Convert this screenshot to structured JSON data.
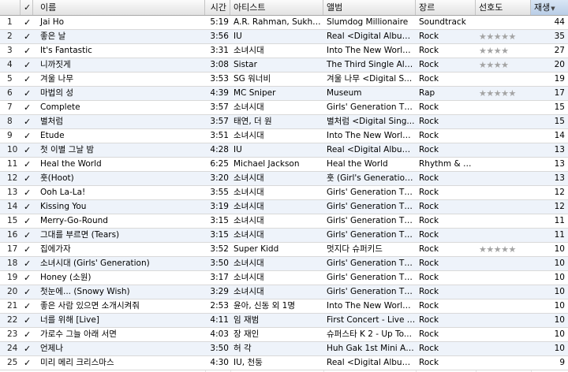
{
  "headers": {
    "check": "✓",
    "name": "이름",
    "time": "시간",
    "artist": "아티스트",
    "album": "앨범",
    "genre": "장르",
    "rating": "선호도",
    "plays": "재생"
  },
  "sort_column": "plays",
  "check_glyph": "✓",
  "rating_star_icon": "star-icon",
  "rows": [
    {
      "num": "1",
      "name": "Jai Ho",
      "time": "5:19",
      "artist": "A.R. Rahman, Sukhvi...",
      "album": "Slumdog Millionaire",
      "genre": "Soundtrack",
      "rating": 0,
      "plays": "44"
    },
    {
      "num": "2",
      "name": "좋은 날",
      "time": "3:56",
      "artist": "IU",
      "album": "Real <Digital Album>",
      "genre": "Rock",
      "rating": 5,
      "plays": "35"
    },
    {
      "num": "3",
      "name": "It's Fantastic",
      "time": "3:31",
      "artist": "소녀시대",
      "album": "Into The New World ...",
      "genre": "Rock",
      "rating": 4,
      "plays": "27"
    },
    {
      "num": "4",
      "name": "니까짓게",
      "time": "3:08",
      "artist": "Sistar",
      "album": "The Third Single Alb...",
      "genre": "Rock",
      "rating": 4,
      "plays": "20"
    },
    {
      "num": "5",
      "name": "겨울 나무",
      "time": "3:53",
      "artist": "SG 워너비",
      "album": "겨울 나무 <Digital S...",
      "genre": "Rock",
      "rating": 0,
      "plays": "19"
    },
    {
      "num": "6",
      "name": "마법의 성",
      "time": "4:39",
      "artist": "MC Sniper",
      "album": "Museum",
      "genre": "Rap",
      "rating": 5,
      "plays": "17"
    },
    {
      "num": "7",
      "name": "Complete",
      "time": "3:57",
      "artist": "소녀시대",
      "album": "Girls' Generation Th...",
      "genre": "Rock",
      "rating": 0,
      "plays": "15"
    },
    {
      "num": "8",
      "name": "별처럼",
      "time": "3:57",
      "artist": "태연, 더 원",
      "album": "별처럼 <Digital Sing...",
      "genre": "Rock",
      "rating": 0,
      "plays": "15"
    },
    {
      "num": "9",
      "name": "Etude",
      "time": "3:51",
      "artist": "소녀시대",
      "album": "Into The New World ...",
      "genre": "Rock",
      "rating": 0,
      "plays": "14"
    },
    {
      "num": "10",
      "name": "첫 이별 그날 밤",
      "time": "4:28",
      "artist": "IU",
      "album": "Real <Digital Album>",
      "genre": "Rock",
      "rating": 0,
      "plays": "13"
    },
    {
      "num": "11",
      "name": "Heal the World",
      "time": "6:25",
      "artist": "Michael Jackson",
      "album": "Heal the World",
      "genre": "Rhythm & B...",
      "rating": 0,
      "plays": "13"
    },
    {
      "num": "12",
      "name": "훗(Hoot)",
      "time": "3:20",
      "artist": "소녀시대",
      "album": "훗 (Girl's Generation...",
      "genre": "Rock",
      "rating": 0,
      "plays": "13"
    },
    {
      "num": "13",
      "name": "Ooh La-La!",
      "time": "3:55",
      "artist": "소녀시대",
      "album": "Girls' Generation Th...",
      "genre": "Rock",
      "rating": 0,
      "plays": "12"
    },
    {
      "num": "14",
      "name": "Kissing You",
      "time": "3:19",
      "artist": "소녀시대",
      "album": "Girls' Generation Th...",
      "genre": "Rock",
      "rating": 0,
      "plays": "12"
    },
    {
      "num": "15",
      "name": "Merry-Go-Round",
      "time": "3:15",
      "artist": "소녀시대",
      "album": "Girls' Generation Th...",
      "genre": "Rock",
      "rating": 0,
      "plays": "11"
    },
    {
      "num": "16",
      "name": "그대를 부르면 (Tears)",
      "time": "3:15",
      "artist": "소녀시대",
      "album": "Girls' Generation Th...",
      "genre": "Rock",
      "rating": 0,
      "plays": "11"
    },
    {
      "num": "17",
      "name": "집에가자",
      "time": "3:52",
      "artist": "Super Kidd",
      "album": "멋지다 슈퍼키드",
      "genre": "Rock",
      "rating": 5,
      "plays": "10"
    },
    {
      "num": "18",
      "name": "소녀시대 (Girls' Generation)",
      "time": "3:50",
      "artist": "소녀시대",
      "album": "Girls' Generation Th...",
      "genre": "Rock",
      "rating": 0,
      "plays": "10"
    },
    {
      "num": "19",
      "name": "Honey (소원)",
      "time": "3:17",
      "artist": "소녀시대",
      "album": "Girls' Generation Th...",
      "genre": "Rock",
      "rating": 0,
      "plays": "10"
    },
    {
      "num": "20",
      "name": "첫눈에... (Snowy Wish)",
      "time": "3:29",
      "artist": "소녀시대",
      "album": "Girls' Generation Th...",
      "genre": "Rock",
      "rating": 0,
      "plays": "10"
    },
    {
      "num": "21",
      "name": "좋은 사람 있으면 소개시켜줘",
      "time": "2:53",
      "artist": "윤아, 신동 외 1명",
      "album": "Into The New World ...",
      "genre": "Rock",
      "rating": 0,
      "plays": "10"
    },
    {
      "num": "22",
      "name": "너를 위해 [Live]",
      "time": "4:11",
      "artist": "임 재범",
      "album": "First Concert - Live &...",
      "genre": "Rock",
      "rating": 0,
      "plays": "10"
    },
    {
      "num": "23",
      "name": "가로수 그늘 아래 서면",
      "time": "4:03",
      "artist": "장 재인",
      "album": "슈퍼스타 K 2 - Up To...",
      "genre": "Rock",
      "rating": 0,
      "plays": "10"
    },
    {
      "num": "24",
      "name": "언제나",
      "time": "3:50",
      "artist": "허 각",
      "album": "Huh Gak 1st Mini Al...",
      "genre": "Rock",
      "rating": 0,
      "plays": "10"
    },
    {
      "num": "25",
      "name": "미리 메리 크리스마스",
      "time": "4:30",
      "artist": "IU, 천둥",
      "album": "Real <Digital Album>",
      "genre": "Rock",
      "rating": 0,
      "plays": "9"
    }
  ],
  "colors": {
    "row_even": "#ffffff",
    "row_odd": "#eef3fa",
    "sorted_header": "#c8d9ee",
    "star": "#a4a4a4"
  }
}
